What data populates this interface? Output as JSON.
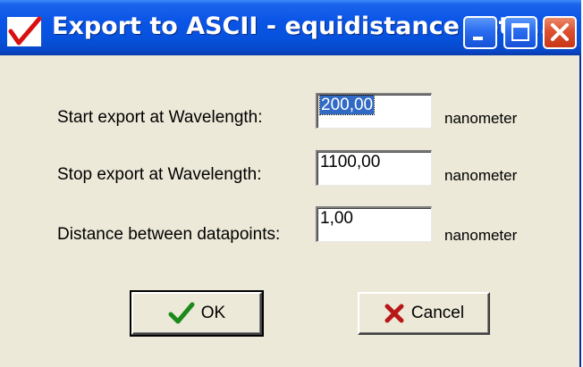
{
  "window": {
    "title": "Export to ASCII - equidistance sett...",
    "icon": "red-checkmark-icon",
    "controls": [
      "minimize-icon",
      "maximize-icon",
      "close-icon"
    ]
  },
  "form": {
    "start": {
      "label": "Start export at Wavelength:",
      "value": "200,00",
      "unit": "nanometer"
    },
    "stop": {
      "label": "Stop export at Wavelength:",
      "value": "1100,00",
      "unit": "nanometer"
    },
    "distance": {
      "label": "Distance between datapoints:",
      "value": "1,00",
      "unit": "nanometer"
    }
  },
  "buttons": {
    "ok": {
      "label": "OK",
      "icon": "green-check-icon"
    },
    "cancel": {
      "label": "Cancel",
      "icon": "red-x-icon"
    }
  },
  "colors": {
    "titlebar": "#0a54e6",
    "dialog_bg": "#ece9d8",
    "selection": "#316ac5",
    "close_button": "#dc5030"
  }
}
